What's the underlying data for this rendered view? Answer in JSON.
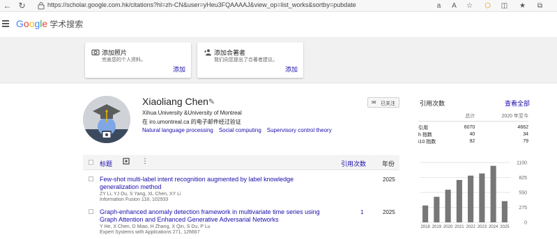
{
  "browser": {
    "url": "https://scholar.google.com.hk/citations?hl=zh-CN&user=yHeu3FQAAAAJ&view_op=list_works&sortby=pubdate",
    "read_aloud_label": "aあ",
    "font_label": "A"
  },
  "header": {
    "logo_parts": [
      "G",
      "o",
      "o",
      "g",
      "l",
      "e"
    ],
    "product": "学术搜索"
  },
  "cards": [
    {
      "title": "添加照片",
      "desc": "完善您的个人资料。",
      "link": "添加",
      "icon": "add-photo-icon"
    },
    {
      "title": "添加合著者",
      "desc": "我们向您提出了合著者建议。",
      "link": "添加",
      "icon": "add-person-icon"
    }
  ],
  "profile": {
    "name": "Xiaoliang Chen",
    "affiliation": "Xihua University &University of Montreal",
    "email": "在 iro.umontreal.ca 的电子邮件经过验证",
    "interests": [
      "Natural language processing",
      "Social computing",
      "Supervisory control theory"
    ],
    "follow_label": "已关注"
  },
  "list": {
    "title_header": "标题",
    "cited_header": "引用次数",
    "year_header": "年份",
    "rows": [
      {
        "title": "Few-shot multi-label intent recognition augmented by label knowledge generalization method",
        "authors": "ZY Li, YJ Du, S Yang, XL Chen, XY Li",
        "venue": "Information Fusion 118, 102933",
        "cited": "",
        "year": "2025"
      },
      {
        "title": "Graph-enhanced anomaly detection framework in multivariate time series using Graph Attention and Enhanced Generative Adversarial Networks",
        "authors": "Y He, X Chen, D Miao, H Zhang, X Qin, S Du, P Lu",
        "venue": "Expert Systems with Applications 271, 126667",
        "cited": "1",
        "year": "2025"
      }
    ]
  },
  "citations": {
    "title": "引用次数",
    "view_all": "查看全部",
    "col_all": "总计",
    "col_since": "2020 年至今",
    "rows": [
      {
        "label": "引用",
        "all": "6070",
        "since": "4662"
      },
      {
        "label": "h 指数",
        "all": "40",
        "since": "34"
      },
      {
        "label": "i10 指数",
        "all": "92",
        "since": "79"
      }
    ]
  },
  "chart_data": {
    "type": "bar",
    "categories": [
      "2018",
      "2019",
      "2020",
      "2021",
      "2022",
      "2023",
      "2024",
      "2025"
    ],
    "values": [
      310,
      470,
      600,
      780,
      860,
      900,
      1040,
      390
    ],
    "ylim": [
      0,
      1100
    ],
    "yticks": [
      "1100",
      "825",
      "550",
      "275",
      "0"
    ],
    "bar_color": "#777777"
  }
}
